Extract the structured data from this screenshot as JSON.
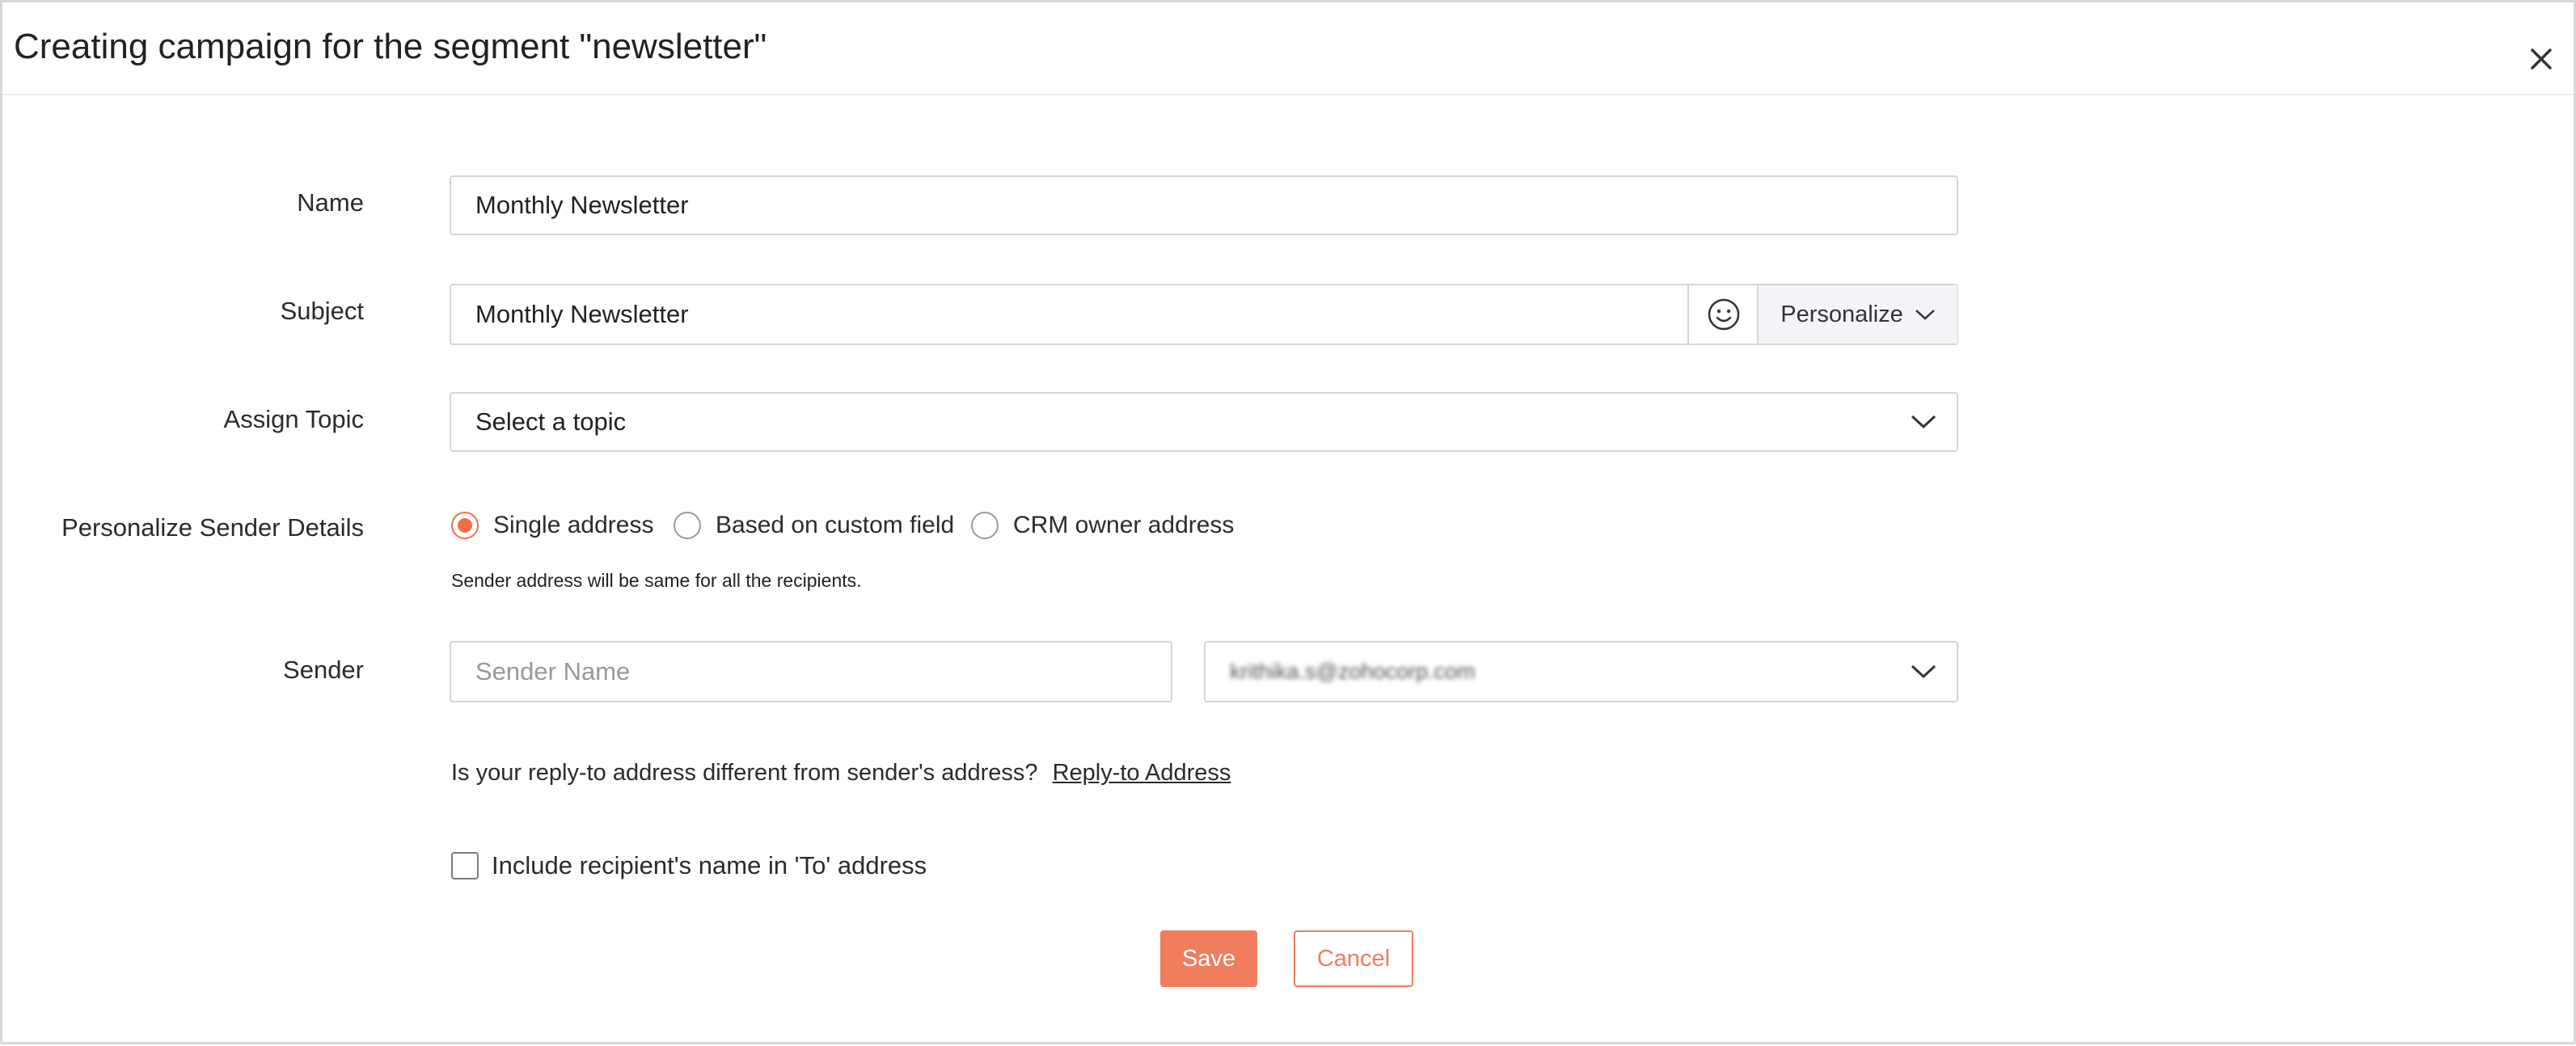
{
  "dialog": {
    "title": "Creating campaign for the segment \"newsletter\"",
    "close_icon": "close-icon"
  },
  "form": {
    "name": {
      "label": "Name",
      "value": "Monthly Newsletter"
    },
    "subject": {
      "label": "Subject",
      "value": "Monthly Newsletter",
      "emoji_icon": "smiley-icon",
      "personalize_label": "Personalize"
    },
    "topic": {
      "label": "Assign Topic",
      "value": "Select a topic"
    },
    "sender_details": {
      "label": "Personalize Sender Details",
      "options": [
        {
          "label": "Single address",
          "selected": true
        },
        {
          "label": "Based on custom field",
          "selected": false
        },
        {
          "label": "CRM owner address",
          "selected": false
        }
      ],
      "hint": "Sender address will be same for all the recipients."
    },
    "sender": {
      "label": "Sender",
      "name_placeholder": "Sender Name",
      "email_value": "krithika.s@zohocorp.com"
    },
    "reply_to": {
      "question": "Is your reply-to address different from sender's address?",
      "link": "Reply-to Address"
    },
    "include_name": {
      "label": "Include recipient's name in 'To' address",
      "checked": false
    }
  },
  "actions": {
    "save": "Save",
    "cancel": "Cancel"
  },
  "colors": {
    "accent": "#f07d5e",
    "radio_selected": "#f0704a",
    "border": "#d5d5d5"
  }
}
